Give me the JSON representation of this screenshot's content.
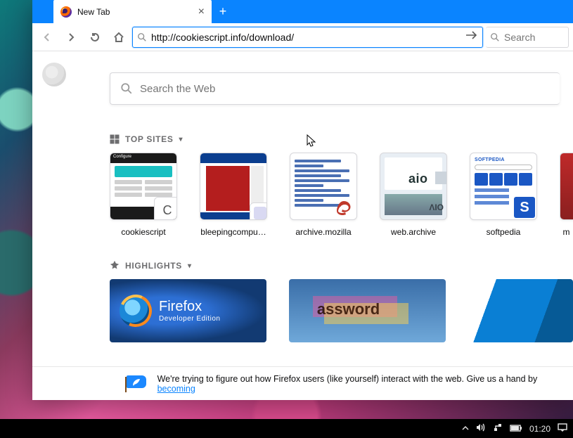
{
  "tab": {
    "title": "New Tab"
  },
  "urlbar": {
    "value": "http://cookiescript.info/download/"
  },
  "searchbar": {
    "placeholder": "Search"
  },
  "bigsearch": {
    "placeholder": "Search the Web"
  },
  "sections": {
    "topsites_label": "TOP SITES",
    "highlights_label": "HIGHLIGHTS"
  },
  "topsites": [
    {
      "label": "cookiescript"
    },
    {
      "label": "bleepingcompu…"
    },
    {
      "label": "archive.mozilla"
    },
    {
      "label": "web.archive"
    },
    {
      "label": "softpedia"
    },
    {
      "label": "m"
    }
  ],
  "thumbtext": {
    "cookiescript_header": "Configure",
    "cookiescript_chip": "C",
    "web_aio": "aio",
    "web_lab": "ΛIO",
    "soft_logo": "SOFTPEDIA",
    "soft_s": "S"
  },
  "highlights_tile1": {
    "line1": "Firefox",
    "line2": "Developer Edition"
  },
  "highlights_tile2": {
    "word": "assword"
  },
  "snippet": {
    "text": "We're trying to figure out how Firefox users (like yourself) interact with the web. Give us a hand by ",
    "link": "becoming "
  },
  "taskbar": {
    "clock": "01:20"
  }
}
